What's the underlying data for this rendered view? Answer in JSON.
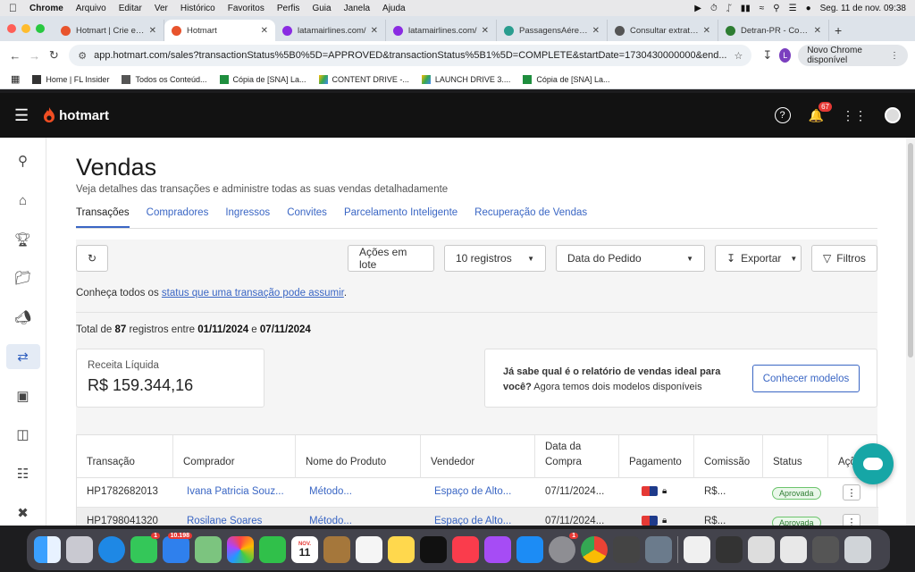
{
  "menubar": {
    "app": "Chrome",
    "items": [
      "Arquivo",
      "Editar",
      "Ver",
      "Histórico",
      "Favoritos",
      "Perfis",
      "Guia",
      "Janela",
      "Ajuda"
    ],
    "clock": "Seg. 11 de nov.  09:38"
  },
  "tabs": [
    {
      "title": "Hotmart | Crie e ve",
      "color": "#e8542d"
    },
    {
      "title": "Hotmart",
      "color": "#e8542d"
    },
    {
      "title": "latamairlines.com/",
      "color": "#8a2be2"
    },
    {
      "title": "latamairlines.com/",
      "color": "#8a2be2"
    },
    {
      "title": "PassagensAéreas.",
      "color": "#2a9d8f"
    },
    {
      "title": "Consultar extrato d",
      "color": "#555555"
    },
    {
      "title": "Detran-PR - Consu",
      "color": "#2e7d32"
    }
  ],
  "address": {
    "url": "app.hotmart.com/sales?transactionStatus%5B0%5D=APPROVED&transactionStatus%5B1%5D=COMPLETE&startDate=1730430000000&end...",
    "profile_initial": "L",
    "update_label": "Novo Chrome disponível"
  },
  "bookmarks": [
    "Home | FL Insider",
    "Todos os Conteúd...",
    "Cópia de [SNA] La...",
    "CONTENT DRIVE -...",
    "LAUNCH DRIVE 3....",
    "Cópia de [SNA] La..."
  ],
  "header": {
    "brand": "hotmart",
    "notifications": "67"
  },
  "page": {
    "title": "Vendas",
    "subtitle": "Veja detalhes das transações e administre todas as suas vendas detalhadamente",
    "tabs": [
      "Transações",
      "Compradores",
      "Ingressos",
      "Convites",
      "Parcelamento Inteligente",
      "Recuperação de Vendas"
    ],
    "active_tab": "Transações"
  },
  "toolbar": {
    "batch_actions": "Ações em lote",
    "records": "10 registros",
    "date_field": "Data do Pedido",
    "export": "Exportar",
    "filters": "Filtros"
  },
  "note": {
    "prefix": "Conheça todos os ",
    "link": "status que uma transação pode assumir",
    "suffix": "."
  },
  "summary": {
    "t1": "Total de ",
    "count": "87",
    "t2": " registros entre ",
    "start": "01/11/2024",
    "t3": " e ",
    "end": "07/11/2024"
  },
  "revenue": {
    "label": "Receita Líquida",
    "value": "R$ 159.344,16"
  },
  "promo": {
    "bold": "Já sabe qual é o relatório de vendas ideal para você?",
    "text": " Agora temos dois modelos disponíveis",
    "button": "Conhecer modelos"
  },
  "table": {
    "headers": {
      "transacao": "Transação",
      "comprador": "Comprador",
      "produto": "Nome do Produto",
      "vendedor": "Vendedor",
      "data_l1": "Data da",
      "data_l2": "Compra",
      "pagamento": "Pagamento",
      "comissao": "Comissão",
      "status": "Status",
      "acoes": "Açõ"
    },
    "rows": [
      {
        "id": "HP1782682013",
        "buyer": "Ivana Patricia Souz...",
        "product": "Método...",
        "seller": "Espaço de Alto...",
        "date": "07/11/2024...",
        "commission": "R$...",
        "status": "Aprovada"
      },
      {
        "id": "HP1798041320",
        "buyer": "Rosilane Soares",
        "product": "Método...",
        "seller": "Espaço de Alto...",
        "date": "07/11/2024...",
        "commission": "R$...",
        "status": "Aprovada"
      }
    ]
  },
  "dock": {
    "mail_badge": "10.198",
    "messages_badge": "1",
    "settings_badge": "1",
    "calendar_month": "NOV.",
    "calendar_day": "11"
  }
}
